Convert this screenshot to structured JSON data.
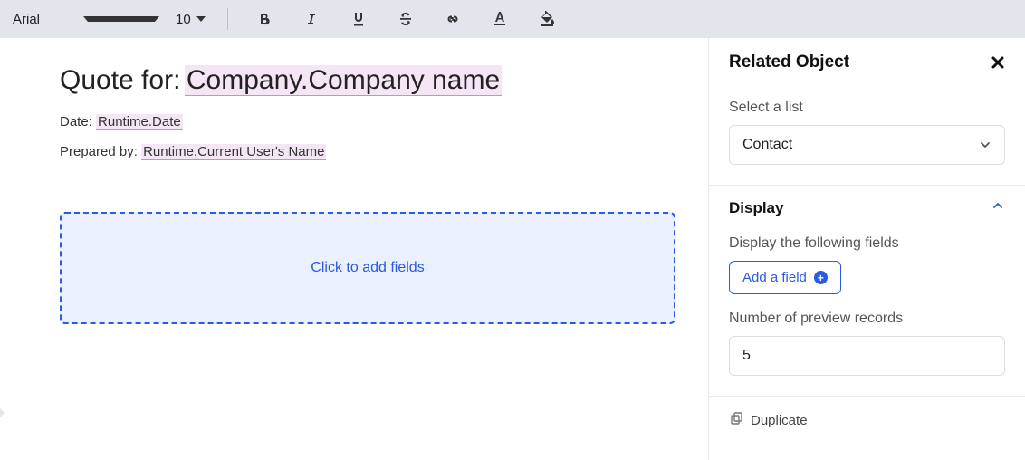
{
  "toolbar": {
    "fontFamily": "Arial",
    "fontSize": "10"
  },
  "editor": {
    "headingPrefix": "Quote for:",
    "headingToken": "Company.Company name",
    "dateLabel": "Date:",
    "dateToken": "Runtime.Date",
    "preparedLabel": "Prepared by:",
    "preparedToken": "Runtime.Current User's Name",
    "fieldBoxLabel": "Click to add fields"
  },
  "sidebar": {
    "title": "Related Object",
    "listLabel": "Select a list",
    "listValue": "Contact",
    "displaySectionTitle": "Display",
    "displayFieldsLabel": "Display the following fields",
    "addFieldLabel": "Add a field",
    "previewCountLabel": "Number of preview records",
    "previewCountValue": "5",
    "duplicateLabel": "Duplicate"
  }
}
